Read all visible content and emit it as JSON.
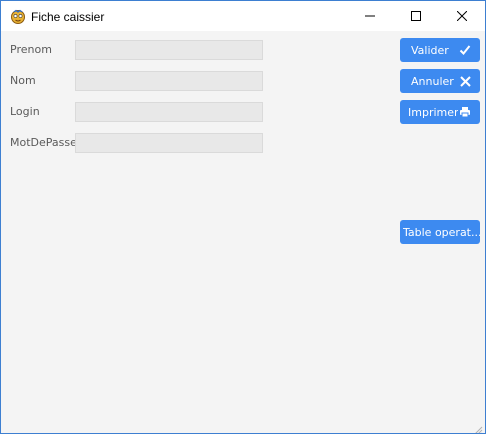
{
  "window": {
    "title": "Fiche caissier",
    "icon": "app-cashier-icon",
    "controls": [
      "minimize-icon",
      "maximize-icon",
      "close-icon"
    ]
  },
  "form": {
    "fields": [
      {
        "label": "Prenom",
        "value": "",
        "placeholder": ""
      },
      {
        "label": "Nom",
        "value": "",
        "placeholder": ""
      },
      {
        "label": "Login",
        "value": "",
        "placeholder": ""
      },
      {
        "label": "MotDePasse",
        "value": "",
        "placeholder": ""
      }
    ]
  },
  "actions": {
    "validate": {
      "label": "Valider",
      "icon": "check-icon"
    },
    "cancel": {
      "label": "Annuler",
      "icon": "x-icon"
    },
    "print": {
      "label": "Imprimer",
      "icon": "printer-icon"
    },
    "table": {
      "label": "Table operat..."
    }
  },
  "colors": {
    "accent": "#3d8af0",
    "window_border": "#3d7fd1",
    "background": "#f4f4f4",
    "field": "#e8e8e8"
  }
}
